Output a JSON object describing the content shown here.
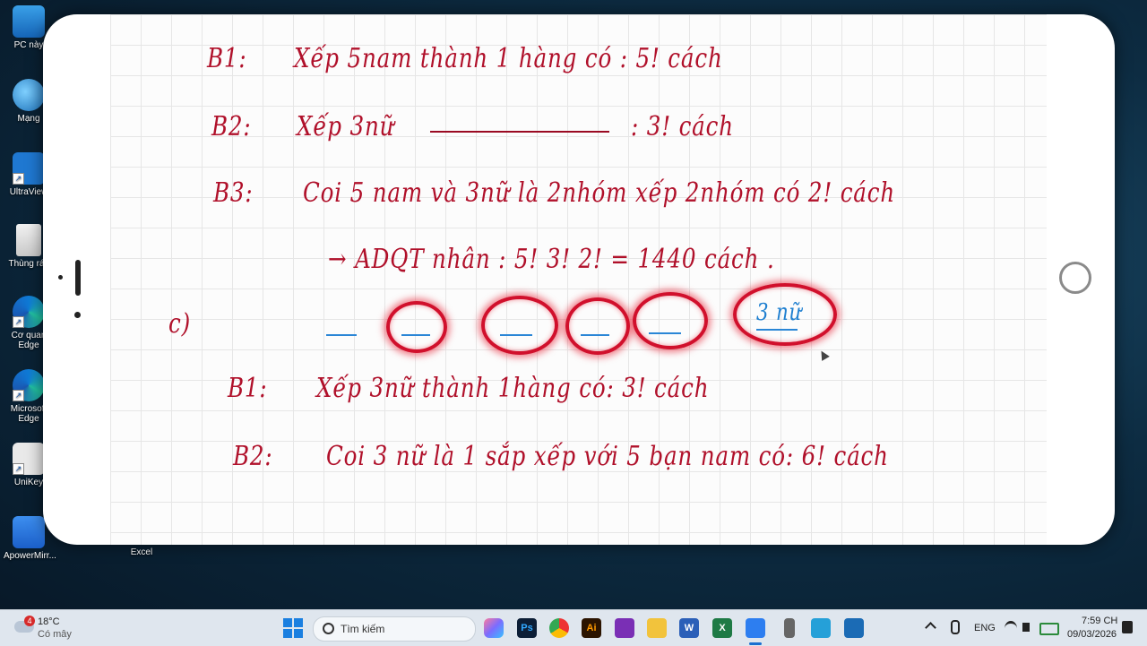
{
  "desktop": {
    "icons": [
      {
        "label": "PC này"
      },
      {
        "label": "Mạng"
      },
      {
        "label": "UltraView"
      },
      {
        "label": "Thùng rác"
      },
      {
        "label": "Cơ quan Edge"
      },
      {
        "label": "Microsoft Edge"
      },
      {
        "label": "UniKey"
      },
      {
        "label": "ApowerMirr..."
      },
      {
        "label": "Excel"
      }
    ]
  },
  "notes": {
    "line1": {
      "step": "B1:",
      "text": "Xếp 5nam thành 1 hàng có : 5! cách"
    },
    "line2": {
      "step": "B2:",
      "text": "Xếp 3nữ",
      "tail": ": 3! cách"
    },
    "line3": {
      "step": "B3:",
      "text": "Coi 5 nam và 3nữ là 2nhóm xếp 2nhóm có 2! cách"
    },
    "line4": {
      "text": "→ ADQT nhân : 5! 3! 2! = 1440 cách ."
    },
    "part": "c)",
    "circle_label": "3 nữ",
    "line5": {
      "step": "B1:",
      "text": "Xếp 3nữ thành 1hàng có: 3! cách"
    },
    "line6": {
      "step": "B2:",
      "text": "Coi 3 nữ là 1 sắp xếp với 5 bạn nam có: 6! cách"
    }
  },
  "taskbar": {
    "weather_temp": "18°C",
    "weather_desc": "Có mây",
    "weather_badge": "4",
    "search_placeholder": "Tìm kiếm",
    "lang": "ENG",
    "time": "7:59 CH",
    "date": "09/03/2026"
  },
  "colors": {
    "ink_red": "#b0102a",
    "ink_blue": "#1e7fd0",
    "highlight": "#d1102c"
  }
}
